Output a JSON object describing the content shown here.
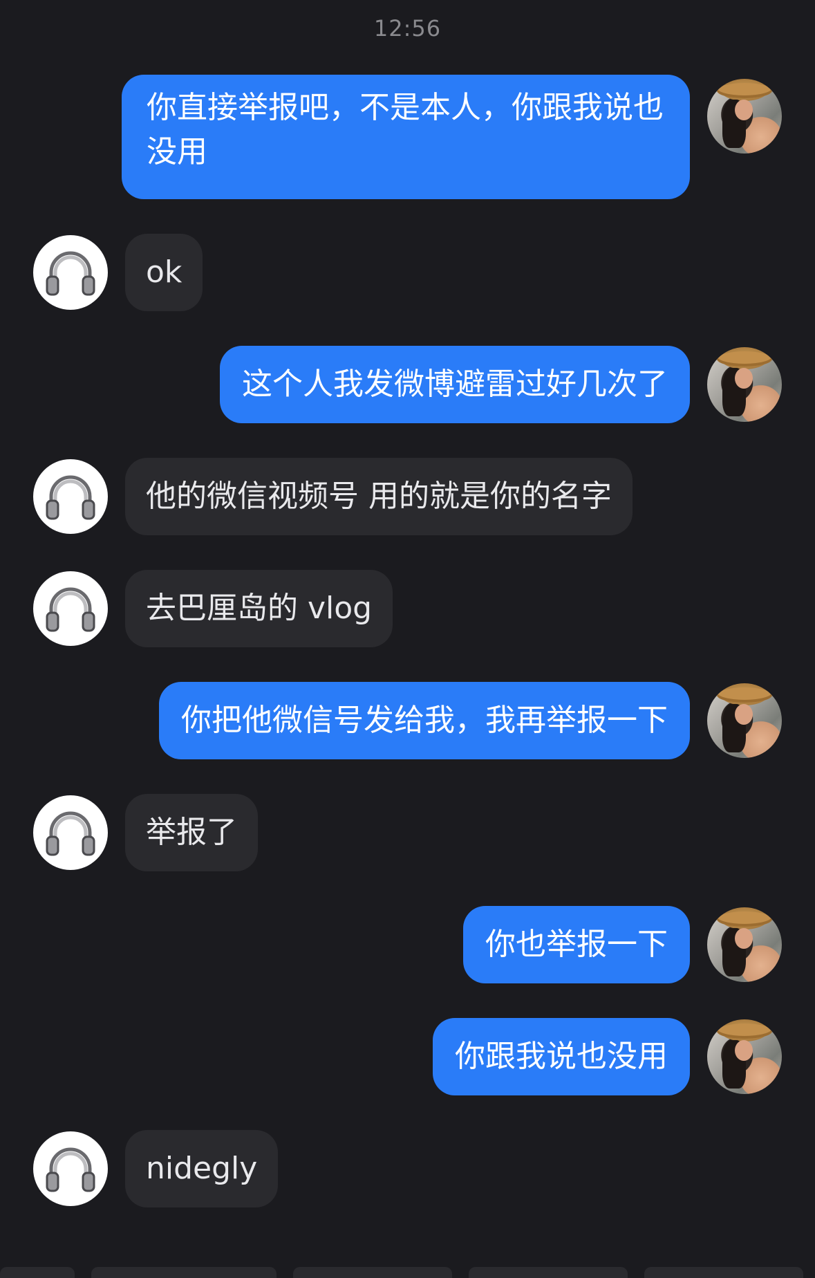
{
  "status": {
    "time": "12:56"
  },
  "contacts": {
    "incoming_avatar": "headphones-icon",
    "outgoing_avatar": "profile-photo"
  },
  "colors": {
    "background": "#1b1b1f",
    "outgoing_bubble": "#2a7cf8",
    "incoming_bubble": "#2a2a2e",
    "timestamp_text": "#8a8a8e"
  },
  "messages": [
    {
      "direction": "outgoing",
      "text": "你直接举报吧，不是本人，你跟我说也没用"
    },
    {
      "direction": "incoming",
      "text": "ok"
    },
    {
      "direction": "outgoing",
      "text": "这个人我发微博避雷过好几次了"
    },
    {
      "direction": "incoming",
      "text": "他的微信视频号 用的就是你的名字"
    },
    {
      "direction": "incoming",
      "text": "去巴厘岛的 vlog"
    },
    {
      "direction": "outgoing",
      "text": "你把他微信号发给我，我再举报一下"
    },
    {
      "direction": "incoming",
      "text": "举报了"
    },
    {
      "direction": "outgoing",
      "text": "你也举报一下"
    },
    {
      "direction": "outgoing",
      "text": "你跟我说也没用"
    },
    {
      "direction": "incoming",
      "text": "nidegly"
    }
  ]
}
